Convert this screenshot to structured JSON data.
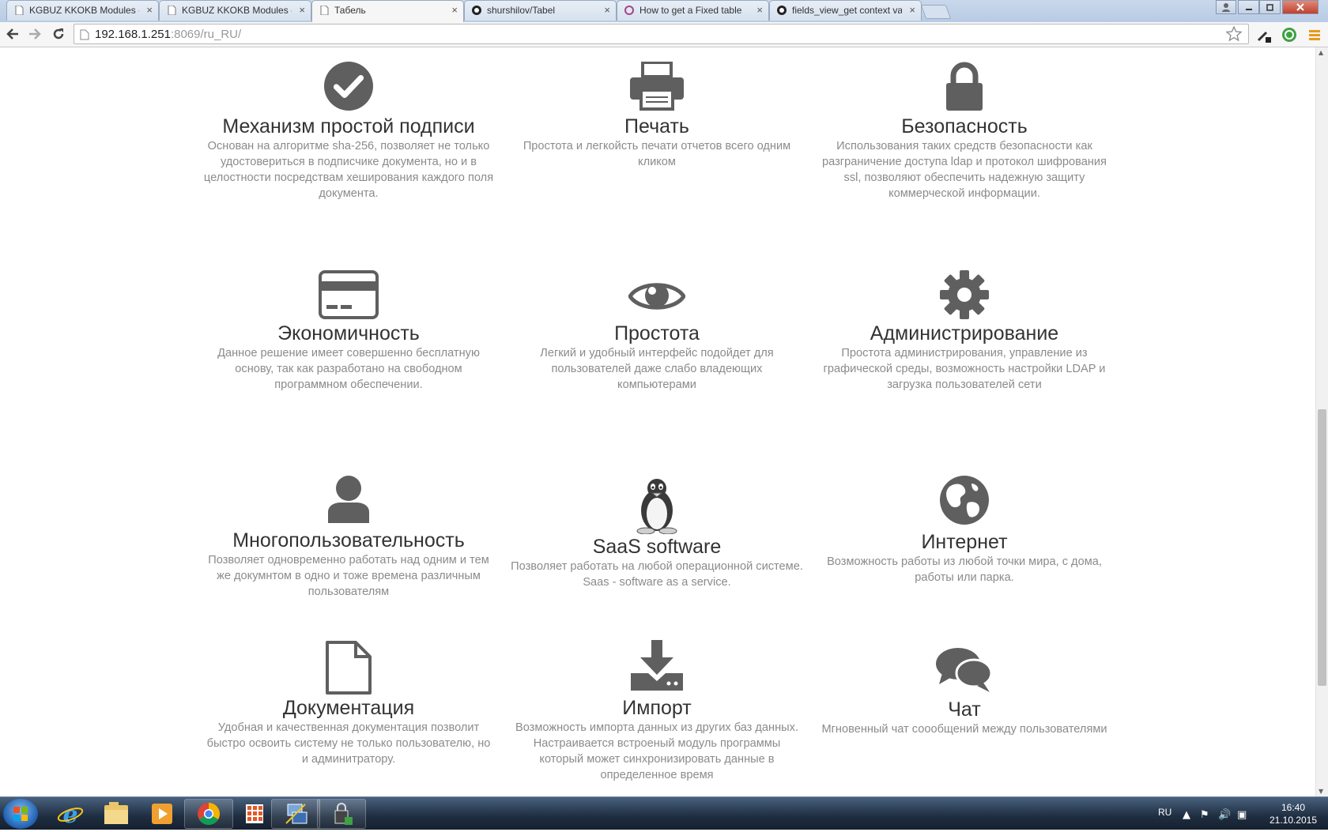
{
  "browser": {
    "tabs": [
      {
        "title": "KGBUZ KKOKB Modules -",
        "icon": "page-icon",
        "active": false
      },
      {
        "title": "KGBUZ KKOKB Modules -",
        "icon": "page-icon",
        "active": false
      },
      {
        "title": "Табель",
        "icon": "page-icon",
        "active": true
      },
      {
        "title": "shurshilov/Tabel",
        "icon": "github-icon",
        "active": false
      },
      {
        "title": "How to get a Fixed table",
        "icon": "odoo-icon",
        "active": false
      },
      {
        "title": "fields_view_get context va",
        "icon": "github-icon",
        "active": false
      }
    ],
    "tab_close_glyph": "×",
    "url_host": "192.168.1.251",
    "url_rest": ":8069/ru_RU/"
  },
  "features": [
    {
      "icon": "checkmark-circle-icon",
      "title": "Механизм простой подписи",
      "desc": "Основан на алгоритме sha-256, позволяет не только удостовериться в подписчике документа, но и в целостности посредствам хеширования каждого поля документа."
    },
    {
      "icon": "printer-icon",
      "title": "Печать",
      "desc": "Простота и легкойсть печати отчетов всего одним кликом"
    },
    {
      "icon": "lock-icon",
      "title": "Безопасность",
      "desc": "Использования таких средств безопасности как разграничение доступа ldap и протокол шифрования ssl, позволяют обеспечить надежную защиту коммерческой информации."
    },
    {
      "icon": "credit-card-icon",
      "title": "Экономичность",
      "desc": "Данное решение имеет совершенно бесплатную основу, так как разработано на свободном программном обеспечении."
    },
    {
      "icon": "eye-icon",
      "title": "Простота",
      "desc": "Легкий и удобный интерфейс подойдет для пользователей даже слабо владеющих компьютерами"
    },
    {
      "icon": "gear-icon",
      "title": "Администрирование",
      "desc": "Простота администрирования, управление из графической среды, возможность настройки LDAP и загрузка пользователей сети"
    },
    {
      "icon": "user-icon",
      "title": "Многопользовательность",
      "desc": "Позволяет одновременно работать над одним и тем же докумнтом в одно и тоже времена различным пользователям"
    },
    {
      "icon": "linux-penguin-icon",
      "title": "SaaS software",
      "desc": "Позволяет работать на любой операционной системе. Saas - software as a service."
    },
    {
      "icon": "globe-icon",
      "title": "Интернет",
      "desc": "Возможность работы из любой точки мира, с дома, работы или парка."
    },
    {
      "icon": "document-icon",
      "title": "Документация",
      "desc": "Удобная и качественная документация позволит быстро освоить систему не только пользователю, но и админитратору."
    },
    {
      "icon": "download-icon",
      "title": "Импорт",
      "desc": "Возможность импорта данных из других баз данных. Настраивается встроеный модуль программы который может синхронизировать данные в определенное время"
    },
    {
      "icon": "chat-bubbles-icon",
      "title": "Чат",
      "desc": "Мгновенный чат соообщений между пользователями"
    }
  ],
  "taskbar": {
    "language": "RU",
    "time": "16:40",
    "date": "21.10.2015",
    "apps": [
      "windows-start-icon",
      "internet-explorer-icon",
      "file-explorer-icon",
      "media-player-icon",
      "chrome-icon",
      "apps-grid-icon",
      "network-settings-icon",
      "security-app-icon"
    ]
  },
  "colors": {
    "icon": "#5f5f5f",
    "title": "#333333",
    "desc": "#8b8b8b"
  }
}
